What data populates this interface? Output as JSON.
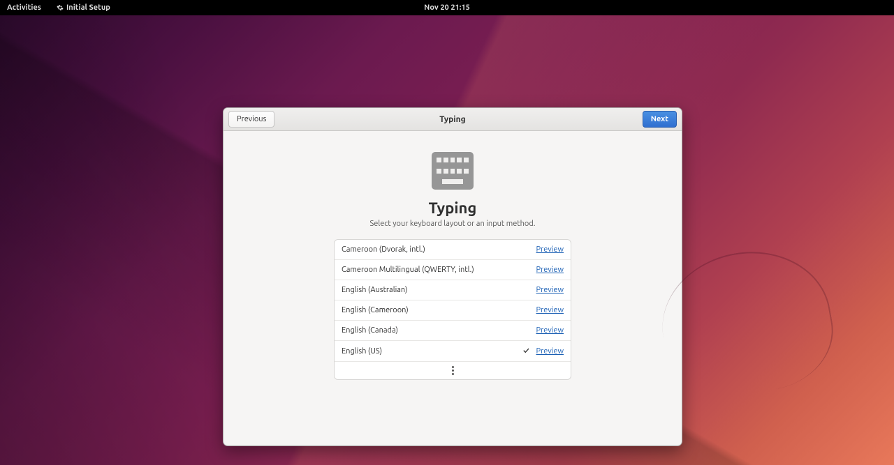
{
  "topbar": {
    "activities": "Activities",
    "app_name": "Initial Setup",
    "clock": "Nov 20  21:15"
  },
  "dialog": {
    "title": "Typing",
    "previous": "Previous",
    "next": "Next",
    "heading": "Typing",
    "subtitle": "Select your keyboard layout or an input method.",
    "preview_label": "Preview",
    "layouts": [
      {
        "name": "Cameroon (Dvorak, intl.)",
        "selected": false
      },
      {
        "name": "Cameroon Multilingual (QWERTY, intl.)",
        "selected": false
      },
      {
        "name": "English (Australian)",
        "selected": false
      },
      {
        "name": "English (Cameroon)",
        "selected": false
      },
      {
        "name": "English (Canada)",
        "selected": false
      },
      {
        "name": "English (US)",
        "selected": true
      }
    ]
  }
}
